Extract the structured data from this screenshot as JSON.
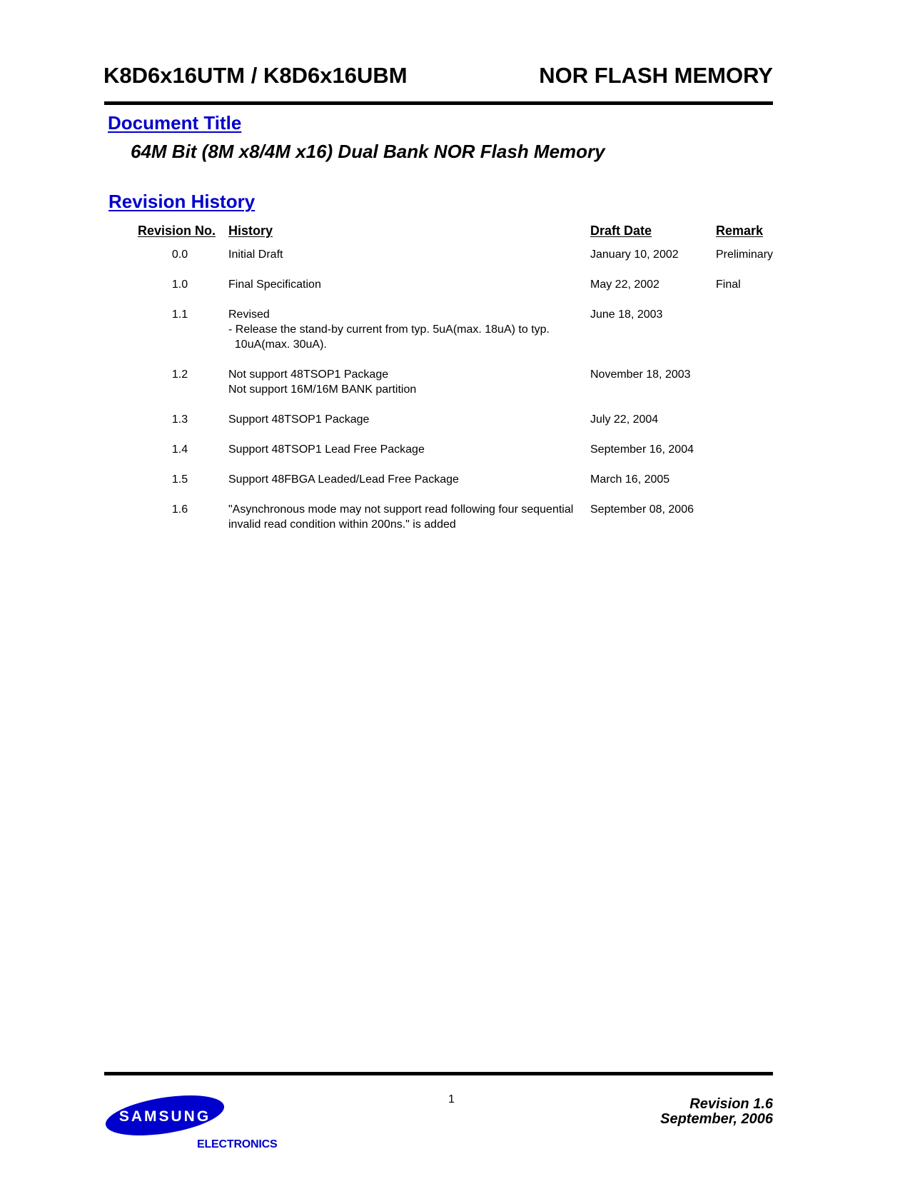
{
  "header": {
    "part_numbers": "K8D6x16UTM / K8D6x16UBM",
    "product_type": "NOR FLASH MEMORY"
  },
  "document_title": {
    "heading": "Document Title",
    "title": "64M Bit (8M x8/4M x16) Dual Bank NOR Flash Memory"
  },
  "revision_history": {
    "heading": "Revision History",
    "columns": {
      "revision_no": "Revision No.",
      "history": "History",
      "draft_date": "Draft Date",
      "remark": "Remark"
    },
    "rows": [
      {
        "revision_no": "0.0",
        "history": [
          "Initial Draft"
        ],
        "draft_date": "January 10, 2002",
        "remark": "Preliminary"
      },
      {
        "revision_no": "1.0",
        "history": [
          "Final Specification"
        ],
        "draft_date": "May 22, 2002",
        "remark": "Final"
      },
      {
        "revision_no": "1.1",
        "history": [
          "Revised",
          "- Release the stand-by current from typ. 5uA(max. 18uA) to typ.",
          "  10uA(max. 30uA)."
        ],
        "draft_date": "June 18, 2003",
        "remark": ""
      },
      {
        "revision_no": "1.2",
        "history": [
          "Not support 48TSOP1 Package",
          "Not support 16M/16M BANK partition"
        ],
        "draft_date": "November 18, 2003",
        "remark": ""
      },
      {
        "revision_no": "1.3",
        "history": [
          "Support 48TSOP1 Package"
        ],
        "draft_date": "July 22, 2004",
        "remark": ""
      },
      {
        "revision_no": "1.4",
        "history": [
          "Support 48TSOP1 Lead Free Package"
        ],
        "draft_date": "September 16, 2004",
        "remark": ""
      },
      {
        "revision_no": "1.5",
        "history": [
          "Support 48FBGA Leaded/Lead Free Package"
        ],
        "draft_date": "March 16, 2005",
        "remark": ""
      },
      {
        "revision_no": "1.6",
        "history": [
          "\"Asynchronous mode may not support read following four sequential",
          "invalid read condition within 200ns.\" is added"
        ],
        "draft_date": "September 08, 2006",
        "remark": ""
      }
    ]
  },
  "footer": {
    "page_number": "1",
    "revision": "Revision 1.6",
    "date": "September, 2006",
    "logo_text": "SAMSUNG",
    "logo_subtext": "ELECTRONICS",
    "brand_color": "#0000cc"
  }
}
